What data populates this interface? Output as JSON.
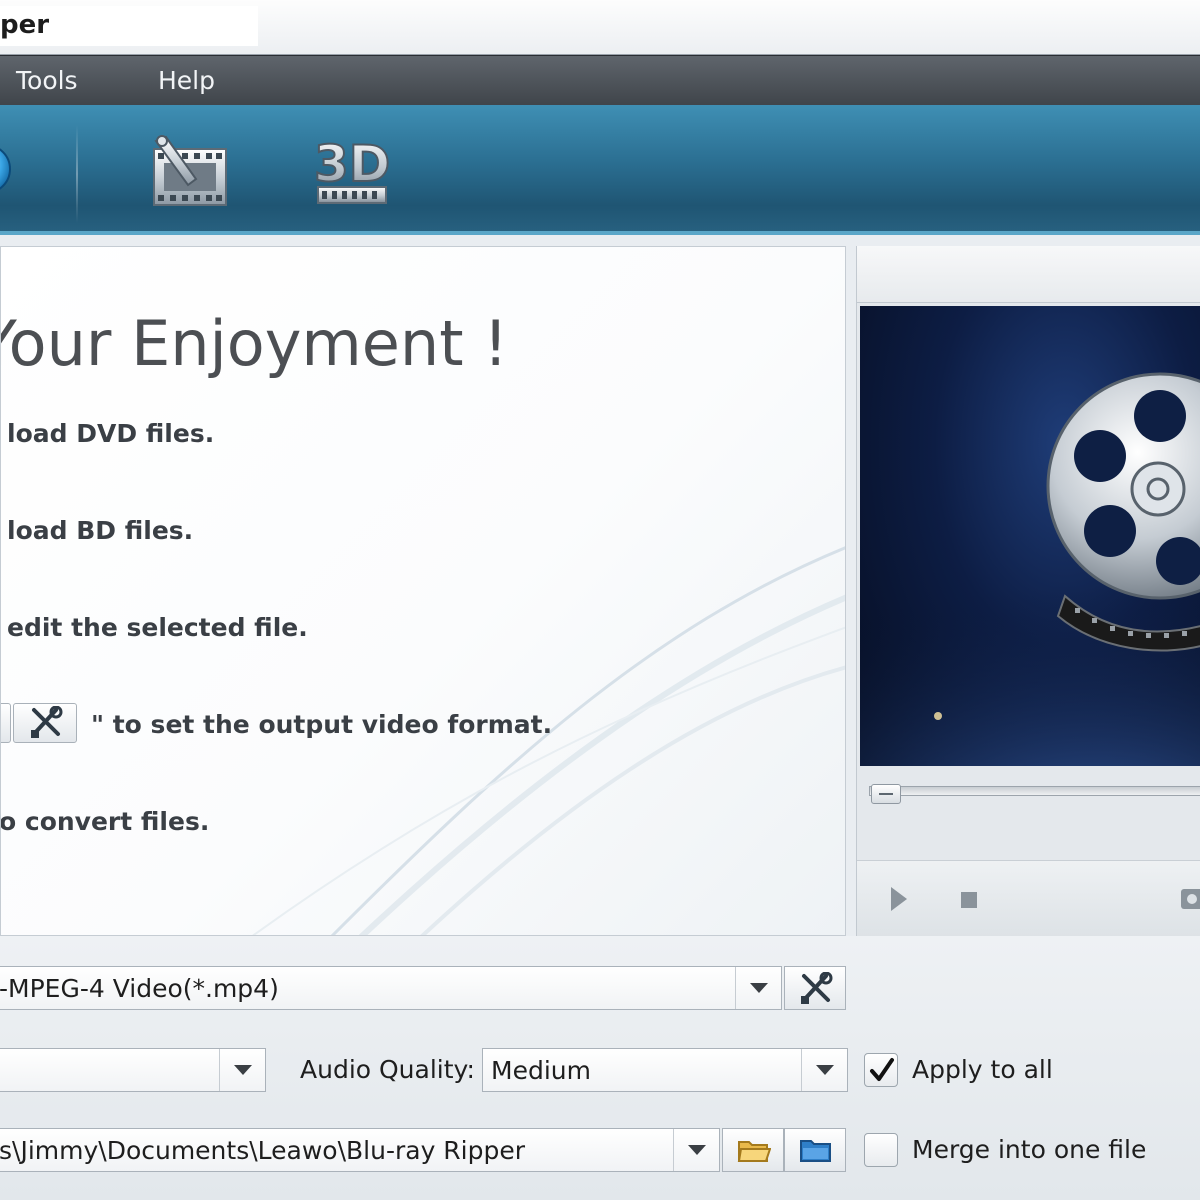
{
  "window": {
    "title": "per"
  },
  "menu": [
    {
      "label": "Tools"
    },
    {
      "label": "Help"
    }
  ],
  "toolbar": {
    "icons": [
      "add-bluray-icon",
      "edit-video-icon",
      "3d-video-icon"
    ],
    "threed_label": "3D"
  },
  "welcome": {
    "title": "Your Enjoyment !",
    "lines": [
      "load DVD files.",
      "load BD files.",
      "edit the selected file.",
      "\" to set the output video format.",
      "o convert files."
    ]
  },
  "settings": {
    "profile": {
      "value": "-MPEG-4 Video(*.mp4)"
    },
    "video_quality": {
      "value": ""
    },
    "audio_quality": {
      "label": "Audio Quality:",
      "value": "Medium"
    },
    "apply_to_all": {
      "label": "Apply to all",
      "checked": true
    },
    "output": {
      "value": "s\\Jimmy\\Documents\\Leawo\\Blu-ray Ripper"
    },
    "merge": {
      "label": "Merge into one file",
      "checked": false
    }
  },
  "colors": {
    "toolbar": "#2b6f92",
    "menubar": "#4a4f55",
    "accent_bar": "#5aa6c8"
  }
}
